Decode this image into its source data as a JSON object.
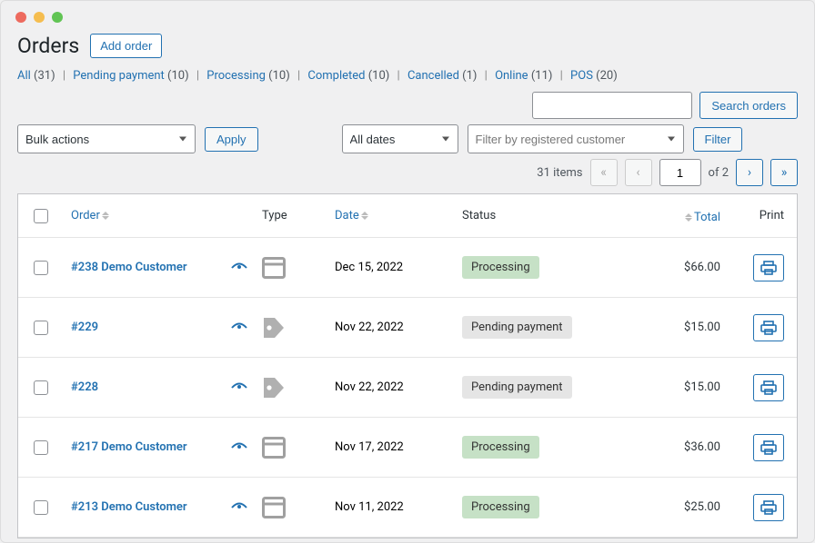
{
  "page_title": "Orders",
  "add_order_label": "Add order",
  "status_filters": [
    {
      "label": "All",
      "count": "(31)"
    },
    {
      "label": "Pending payment",
      "count": "(10)"
    },
    {
      "label": "Processing",
      "count": "(10)"
    },
    {
      "label": "Completed",
      "count": "(10)"
    },
    {
      "label": "Cancelled",
      "count": "(1)"
    },
    {
      "label": "Online",
      "count": "(11)"
    },
    {
      "label": "POS",
      "count": "(20)"
    }
  ],
  "search": {
    "placeholder": "",
    "button": "Search orders"
  },
  "toolbar": {
    "bulk_actions": "Bulk actions",
    "apply": "Apply",
    "all_dates": "All dates",
    "filter_customer_placeholder": "Filter by registered customer",
    "filter": "Filter"
  },
  "pagination": {
    "items_label": "31 items",
    "current": "1",
    "of_label": "of 2"
  },
  "columns": {
    "order": "Order",
    "type": "Type",
    "date": "Date",
    "status": "Status",
    "total": "Total",
    "print": "Print"
  },
  "orders": [
    {
      "title": "#238 Demo Customer",
      "type": "browser",
      "date": "Dec 15, 2022",
      "status": "Processing",
      "status_class": "processing",
      "total": "$66.00"
    },
    {
      "title": "#229",
      "type": "tag",
      "date": "Nov 22, 2022",
      "status": "Pending payment",
      "status_class": "pending",
      "total": "$15.00"
    },
    {
      "title": "#228",
      "type": "tag",
      "date": "Nov 22, 2022",
      "status": "Pending payment",
      "status_class": "pending",
      "total": "$15.00"
    },
    {
      "title": "#217 Demo Customer",
      "type": "browser",
      "date": "Nov 17, 2022",
      "status": "Processing",
      "status_class": "processing",
      "total": "$36.00"
    },
    {
      "title": "#213 Demo Customer",
      "type": "browser",
      "date": "Nov 11, 2022",
      "status": "Processing",
      "status_class": "processing",
      "total": "$25.00"
    }
  ]
}
